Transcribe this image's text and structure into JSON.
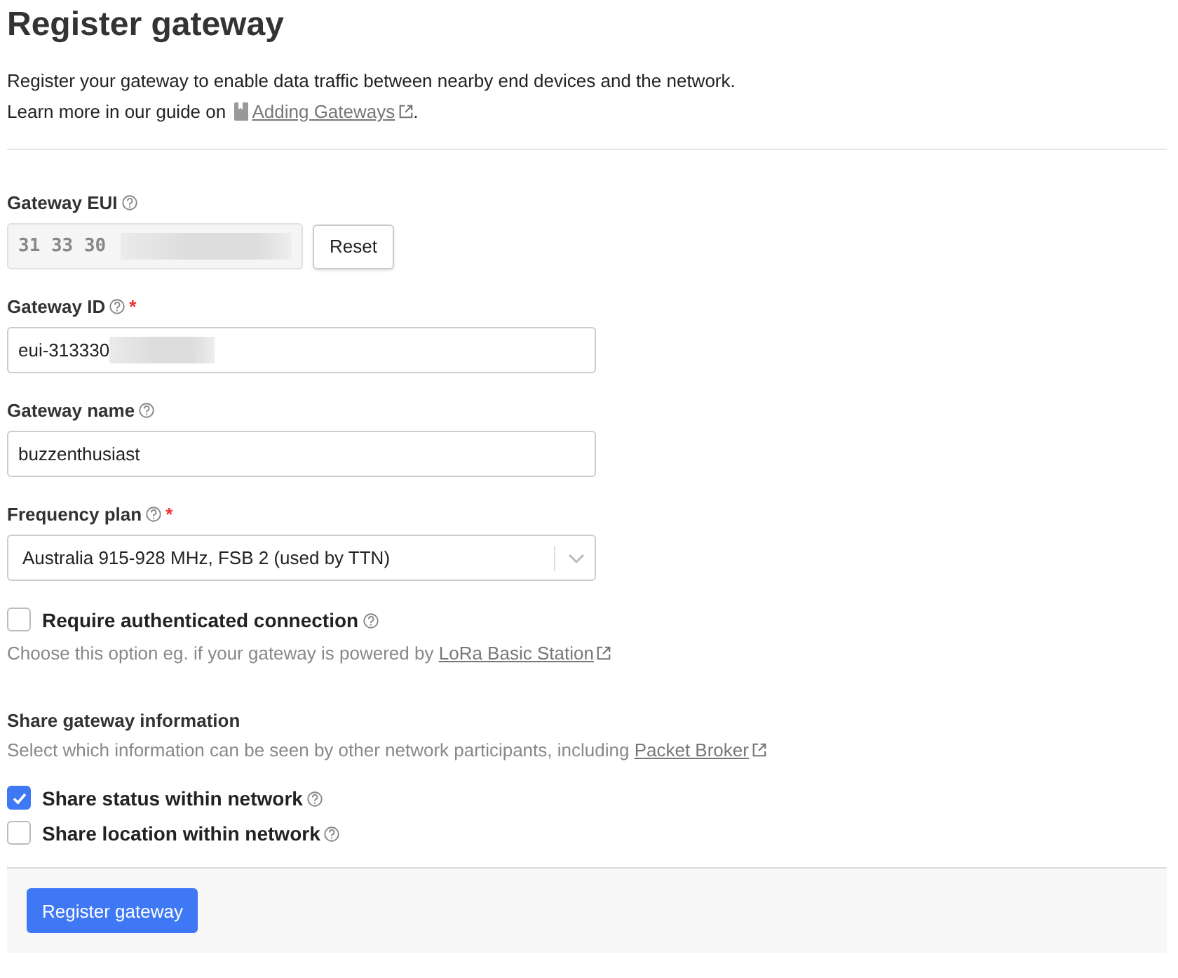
{
  "title": "Register gateway",
  "intro": "Register your gateway to enable data traffic between nearby end devices and the network.",
  "guide": {
    "prefix": "Learn more in our guide on",
    "link": "Adding Gateways",
    "suffix": "."
  },
  "fields": [
    {
      "kind": "eui",
      "label": "Gateway EUI",
      "value": "31 33 30",
      "redacted": true,
      "button": "Reset"
    },
    {
      "kind": "text",
      "label": "Gateway ID",
      "required_mark": "*",
      "value": "eui-313330",
      "redacted": true
    },
    {
      "kind": "text",
      "label": "Gateway name",
      "value": "buzzenthusiast",
      "redacted": false
    },
    {
      "kind": "select",
      "label": "Frequency plan",
      "required_mark": "*",
      "value": "Australia 915-928 MHz, FSB 2 (used by TTN)",
      "redacted": false
    }
  ],
  "auth": {
    "label": "Require authenticated connection",
    "checked": false,
    "hint": "Choose this option eg. if your gateway is powered by",
    "link": "LoRa Basic Station"
  },
  "share": {
    "title": "Share gateway information",
    "description": "Select which information can be seen by other network participants, including",
    "link": "Packet Broker",
    "options": [
      {
        "label": "Share status within network",
        "checked": true
      },
      {
        "label": "Share location within network",
        "checked": false
      }
    ]
  },
  "submit": "Register gateway"
}
